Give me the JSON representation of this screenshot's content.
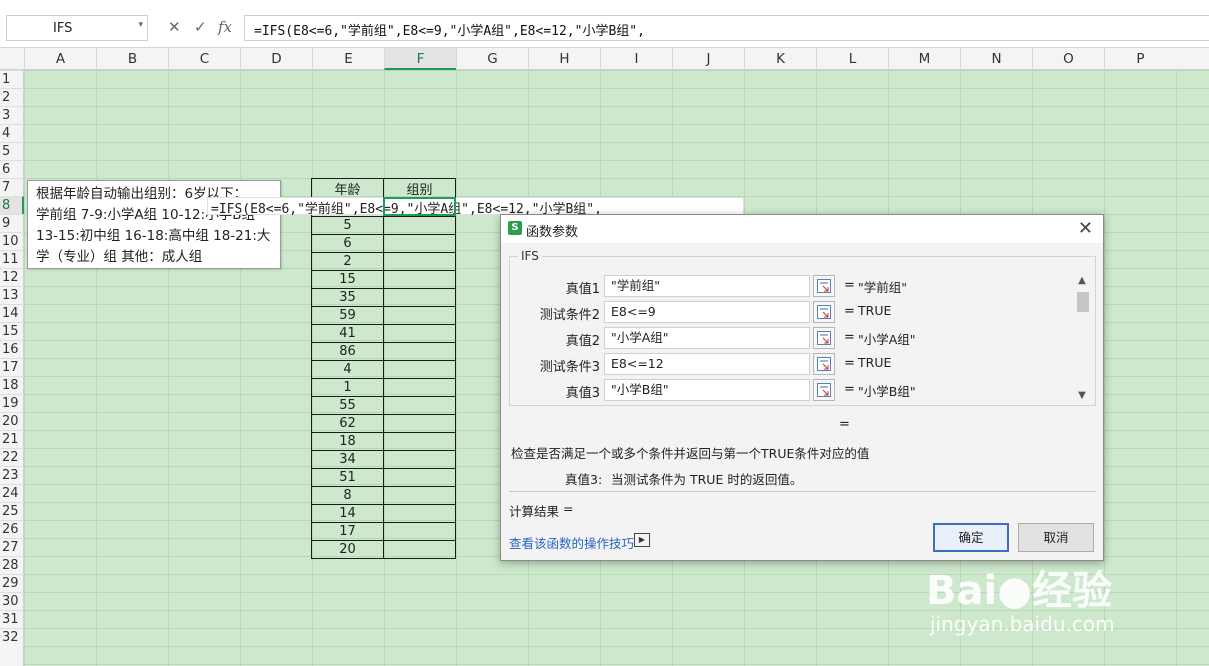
{
  "formula_bar": {
    "name_box": "IFS",
    "cancel_icon": "close-icon",
    "confirm_icon": "check-icon",
    "fx_label": "fx",
    "formula": "=IFS(E8<=6,\"学前组\",E8<=9,\"小学A组\",E8<=12,\"小学B组\","
  },
  "columns": [
    "A",
    "B",
    "C",
    "D",
    "E",
    "F",
    "G",
    "H",
    "I",
    "J",
    "K",
    "L",
    "M",
    "N",
    "O",
    "P"
  ],
  "rows": [
    "1",
    "2",
    "3",
    "4",
    "5",
    "6",
    "7",
    "8",
    "9",
    "10",
    "11",
    "12",
    "13",
    "14",
    "15",
    "16",
    "17",
    "18",
    "19",
    "20",
    "21",
    "22",
    "23",
    "24",
    "25",
    "26",
    "27",
    "28",
    "29",
    "30",
    "31",
    "32"
  ],
  "active_cell": "F8",
  "table": {
    "header_age": "年龄",
    "header_group": "组别",
    "ages": [
      "",
      "5",
      "6",
      "2",
      "15",
      "35",
      "59",
      "41",
      "86",
      "4",
      "1",
      "55",
      "62",
      "18",
      "34",
      "51",
      "8",
      "14",
      "17",
      "20"
    ]
  },
  "comment": {
    "lines": [
      "根据年龄自动输出组别：6岁以下：",
      "学前组 7-9:小学A组 10-12:小学B组",
      "13-15:初中组 16-18:高中组 18-21:大",
      "学（专业）组 其他：成人组"
    ]
  },
  "cell_edit_text": "=IFS(E8<=6,\"学前组\",E8<=9,\"小学A组\",E8<=12,\"小学B组\",",
  "dialog": {
    "title": "函数参数",
    "logo": "S",
    "function_name": "IFS",
    "args": [
      {
        "label": "真值1",
        "value": "\"学前组\"",
        "result": "\"学前组\""
      },
      {
        "label": "测试条件2",
        "value": "E8<=9",
        "result": "TRUE"
      },
      {
        "label": "真值2",
        "value": "\"小学A组\"",
        "result": "\"小学A组\""
      },
      {
        "label": "测试条件3",
        "value": "E8<=12",
        "result": "TRUE"
      },
      {
        "label": "真值3",
        "value": "\"小学B组\"",
        "result": "\"小学B组\""
      }
    ],
    "eq": "=",
    "total_eq": "=",
    "description": "检查是否满足一个或多个条件并返回与第一个TRUE条件对应的值",
    "arg_desc_label": "真值3:",
    "arg_desc_text": "当测试条件为 TRUE 时的返回值。",
    "calc_result_label": "计算结果",
    "calc_result_eq": "=",
    "help_link": "查看该函数的操作技巧",
    "ok_label": "确定",
    "cancel_label": "取消"
  },
  "watermark": {
    "logo": "Bai●经验",
    "url": "jingyan.baidu.com"
  },
  "colors": {
    "sheet_bg": "#cde8cd",
    "selection": "#1f9d55",
    "link": "#2a64c6",
    "ok_border": "#3a6fc4"
  }
}
